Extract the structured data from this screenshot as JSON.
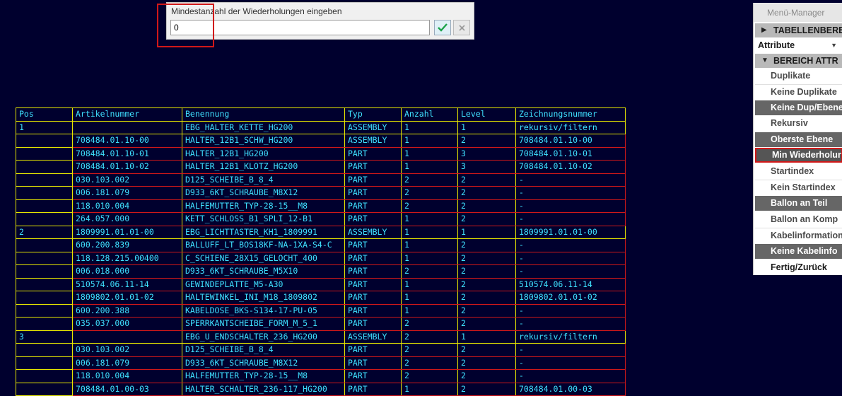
{
  "dialog": {
    "prompt": "Mindestanzahl der Wiederholungen eingeben",
    "value": "0",
    "ok_icon": "checkmark-icon",
    "cancel_icon": "close-icon"
  },
  "table": {
    "headers": [
      "Pos",
      "Artikelnummer",
      "Benennung",
      "Typ",
      "Anzahl",
      "Level",
      "Zeichnungsnummer"
    ],
    "rows": [
      [
        "1",
        "",
        "EBG_HALTER_KETTE_HG200",
        "ASSEMBLY",
        "1",
        "1",
        "rekursiv/filtern"
      ],
      [
        "",
        "708484.01.10-00",
        "HALTER_12B1_SCHW_HG200",
        "ASSEMBLY",
        "1",
        "2",
        "708484.01.10-00"
      ],
      [
        "",
        "708484.01.10-01",
        "HALTER_12B1_HG200",
        "PART",
        "1",
        "3",
        "708484.01.10-01"
      ],
      [
        "",
        "708484.01.10-02",
        "HALTER_12B1_KLOTZ_HG200",
        "PART",
        "1",
        "3",
        "708484.01.10-02"
      ],
      [
        "",
        "030.103.002",
        "D125_SCHEIBE_B_8_4",
        "PART",
        "2",
        "2",
        "-"
      ],
      [
        "",
        "006.181.079",
        "D933_6KT_SCHRAUBE_M8X12",
        "PART",
        "2",
        "2",
        "-"
      ],
      [
        "",
        "118.010.004",
        "HALFEMUTTER_TYP-28-15__M8",
        "PART",
        "2",
        "2",
        "-"
      ],
      [
        "",
        "264.057.000",
        "KETT_SCHLOSS_B1_SPLI_12-B1",
        "PART",
        "1",
        "2",
        "-"
      ],
      [
        "2",
        "1809991.01.01-00",
        "EBG_LICHTTASTER_KH1_1809991",
        "ASSEMBLY",
        "1",
        "1",
        "1809991.01.01-00"
      ],
      [
        "",
        "600.200.839",
        "BALLUFF_LT_BOS18KF-NA-1XA-S4-C",
        "PART",
        "1",
        "2",
        "-"
      ],
      [
        "",
        "118.128.215.00400",
        "C_SCHIENE_28X15_GELOCHT_400",
        "PART",
        "1",
        "2",
        "-"
      ],
      [
        "",
        "006.018.000",
        "D933_6KT_SCHRAUBE_M5X10",
        "PART",
        "2",
        "2",
        "-"
      ],
      [
        "",
        "510574.06.11-14",
        "GEWINDEPLATTE_M5-A30",
        "PART",
        "1",
        "2",
        "510574.06.11-14"
      ],
      [
        "",
        "1809802.01.01-02",
        "HALTEWINKEL_INI_M18_1809802",
        "PART",
        "1",
        "2",
        "1809802.01.01-02"
      ],
      [
        "",
        "600.200.388",
        "KABELDOSE_BKS-S134-17-PU-05",
        "PART",
        "1",
        "2",
        "-"
      ],
      [
        "",
        "035.037.000",
        "SPERRKANTSCHEIBE_FORM_M_5_1",
        "PART",
        "2",
        "2",
        "-"
      ],
      [
        "3",
        "",
        "EBG_U_ENDSCHALTER_236_HG200",
        "ASSEMBLY",
        "2",
        "1",
        "rekursiv/filtern"
      ],
      [
        "",
        "030.103.002",
        "D125_SCHEIBE_B_8_4",
        "PART",
        "2",
        "2",
        "-"
      ],
      [
        "",
        "006.181.079",
        "D933_6KT_SCHRAUBE_M8X12",
        "PART",
        "2",
        "2",
        "-"
      ],
      [
        "",
        "118.010.004",
        "HALFEMUTTER_TYP-28-15__M8",
        "PART",
        "2",
        "2",
        "-"
      ],
      [
        "",
        "708484.01.00-03",
        "HALTER_SCHALTER_236-117_HG200",
        "PART",
        "1",
        "2",
        "708484.01.00-03"
      ]
    ]
  },
  "menu": {
    "title": "Menü-Manager",
    "section_table": "TABELLENBEREICHE",
    "attribute_select": "Attribute",
    "section_attr": "BEREICH ATTR",
    "items": [
      "Duplikate",
      "Keine Duplikate",
      "Keine Dup/Ebene",
      "Rekursiv",
      "Oberste Ebene",
      "Min Wiederholung",
      "Startindex",
      "Kein Startindex",
      "Ballon an Teil",
      "Ballon an Komp",
      "Kabelinformation",
      "Keine Kabelinfo",
      "Fertig/Zurück"
    ]
  },
  "colors": {
    "background": "#00002e",
    "grid": "#e6e600",
    "highlight": "#d01818",
    "text": "#3fe0ff"
  }
}
